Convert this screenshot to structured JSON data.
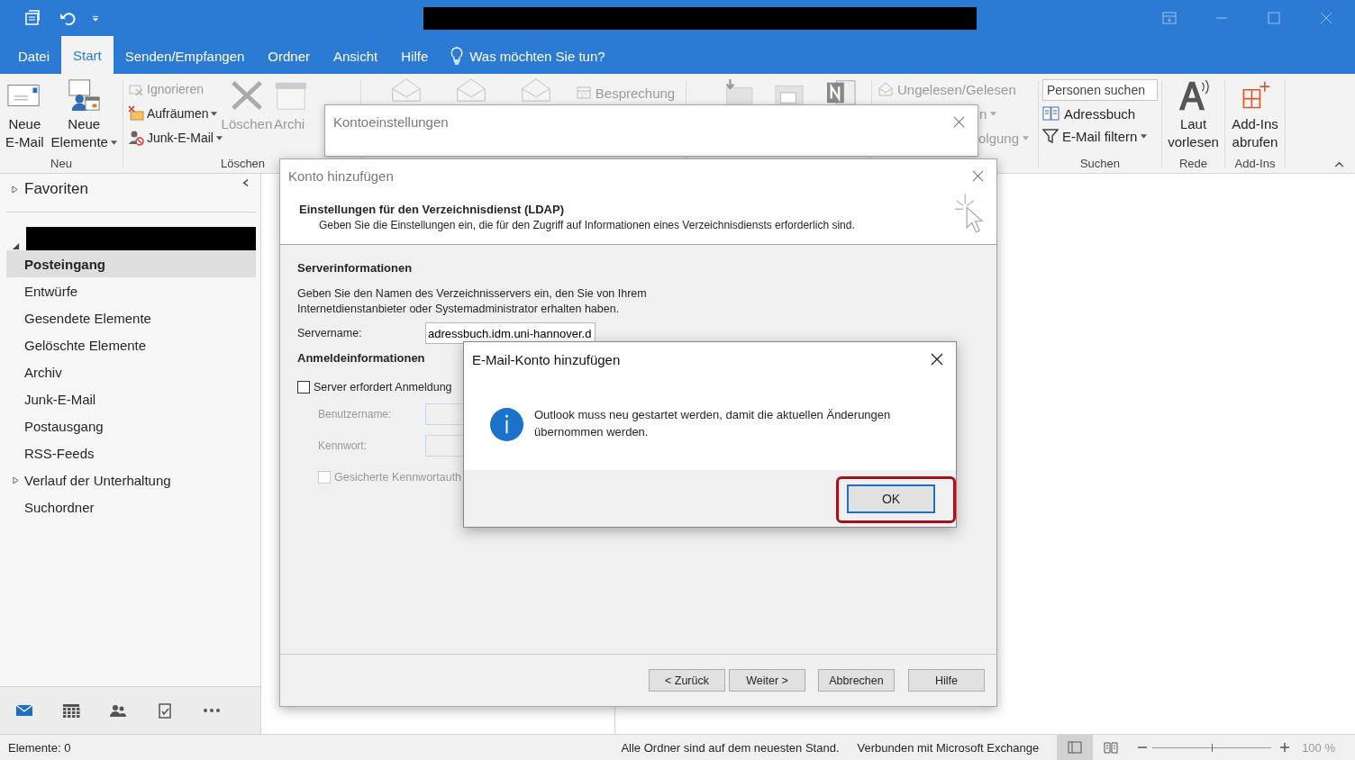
{
  "tabs": [
    {
      "label": "Datei",
      "selected": false
    },
    {
      "label": "Start",
      "selected": true
    },
    {
      "label": "Senden/Empfangen",
      "selected": false
    },
    {
      "label": "Ordner",
      "selected": false
    },
    {
      "label": "Ansicht",
      "selected": false
    },
    {
      "label": "Hilfe",
      "selected": false
    }
  ],
  "tell_me": "Was möchten Sie tun?",
  "ribbon": {
    "new_group": {
      "label": "Neu",
      "buttons": [
        {
          "lines": [
            "Neue",
            "E-Mail"
          ],
          "dropdown": false
        },
        {
          "lines": [
            "Neue",
            "Elemente"
          ],
          "dropdown": true
        }
      ]
    },
    "delete_group": {
      "label": "Löschen",
      "small": [
        {
          "label": "Ignorieren",
          "disabled": true,
          "dropdown": false
        },
        {
          "label": "Aufräumen",
          "disabled": false,
          "dropdown": true
        },
        {
          "label": "Junk-E-Mail",
          "disabled": false,
          "dropdown": true
        }
      ],
      "large": [
        {
          "label": "Löschen",
          "disabled": true
        },
        {
          "label": "Archi",
          "disabled": true
        }
      ]
    },
    "respond_group": {
      "small": [
        {
          "label": "Besprechung",
          "disabled": true
        }
      ]
    },
    "tags_group": {
      "small": [
        {
          "label": "Ungelesen/Gelesen",
          "disabled": true,
          "dropdown": false
        },
        {
          "label": "n",
          "disabled": true,
          "dropdown": true
        },
        {
          "label": "olgung",
          "disabled": true,
          "dropdown": true
        }
      ]
    },
    "find_group": {
      "label": "Suchen",
      "search": {
        "placeholder": "Personen suchen"
      },
      "small": [
        {
          "label": "Adressbuch",
          "dropdown": false
        },
        {
          "label": "E-Mail filtern",
          "dropdown": true
        }
      ]
    },
    "speech_group": {
      "label": "Rede",
      "button": [
        "Laut",
        "vorlesen"
      ]
    },
    "addins_group": {
      "label": "Add-Ins",
      "button": [
        "Add-Ins",
        "abrufen"
      ]
    }
  },
  "favorites": {
    "label": "Favoriten",
    "expanded": false
  },
  "account": {
    "expanded": true
  },
  "folders": [
    {
      "label": "Posteingang",
      "selected": true
    },
    {
      "label": "Entwürfe",
      "selected": false
    },
    {
      "label": "Gesendete Elemente",
      "selected": false
    },
    {
      "label": "Gelöschte Elemente",
      "selected": false
    },
    {
      "label": "Archiv",
      "selected": false
    },
    {
      "label": "Junk-E-Mail",
      "selected": false
    },
    {
      "label": "Postausgang",
      "selected": false
    },
    {
      "label": "RSS-Feeds",
      "selected": false
    },
    {
      "label": "Verlauf der Unterhaltung",
      "selected": false,
      "expanded": false
    },
    {
      "label": "Suchordner",
      "selected": false
    }
  ],
  "bottom_nav": [
    {
      "selected": true
    },
    {
      "selected": false
    },
    {
      "selected": false
    },
    {
      "selected": false
    },
    {
      "selected": false
    }
  ],
  "status_bar": {
    "items_count": "Elemente: 0",
    "sync": "Alle Ordner sind auf dem neuesten Stand.",
    "connection": "Verbunden mit Microsoft Exchange",
    "views": [
      {
        "selected": true
      },
      {
        "selected": false
      }
    ],
    "zoom": {
      "level": 0.5,
      "reading": "100 %"
    }
  },
  "account_settings": {
    "title": "Kontoeinstellungen"
  },
  "add_account": {
    "title": "Konto hinzufügen",
    "heading": "Einstellungen für den Verzeichnisdienst (LDAP)",
    "subheading": "Geben Sie die Einstellungen ein, die für den Zugriff auf Informationen eines Verzeichnisdiensts erforderlich sind.",
    "server_section": "Serverinformationen",
    "server_hint": "Geben Sie den Namen des Verzeichnisservers ein, den Sie von Ihrem Internetdienstanbieter oder Systemadministrator erhalten haben.",
    "server_label": "Servername:",
    "server_value": "adressbuch.idm.uni-hannover.d",
    "login_section": "Anmeldeinformationen",
    "login_required": {
      "label": "Server erfordert Anmeldung",
      "checked": false
    },
    "username_label": "Benutzername:",
    "password_label": "Kennwort:",
    "spa": {
      "label": "Gesicherte Kennwortauth",
      "checked": false,
      "disabled": true
    },
    "buttons": [
      "< Zurück",
      "Weiter >",
      "Abbrechen",
      "Hilfe"
    ]
  },
  "message_box": {
    "title": "E-Mail-Konto hinzufügen",
    "message": "Outlook muss neu gestartet werden, damit die aktuellen Änderungen übernommen werden.",
    "button": "OK"
  }
}
